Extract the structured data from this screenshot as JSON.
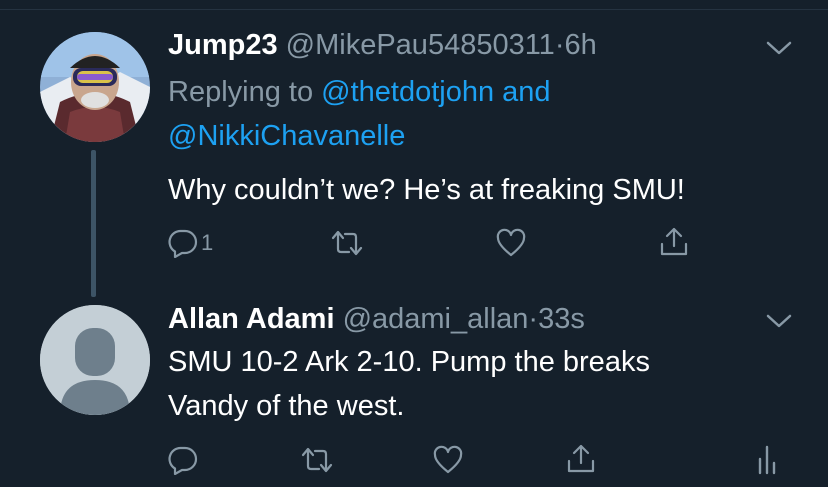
{
  "colors": {
    "background": "#15202b",
    "text": "#ffffff",
    "secondary": "#8899a6",
    "link": "#1da1f2",
    "thread_line": "#3d5466"
  },
  "tweet1": {
    "name": "Jump23",
    "handle": "@MikePau54850311",
    "separator": "·",
    "time": "6h",
    "replying_prefix": "Replying to",
    "mention1": "@thetdotjohn",
    "and_word": "and",
    "mention2": "@NikkiChavanelle",
    "text": "Why couldn’t we?  He’s at freaking SMU!",
    "reply_count": "1",
    "icons": [
      "reply-icon",
      "retweet-icon",
      "like-icon",
      "share-icon",
      "chevron-down-icon"
    ]
  },
  "tweet2": {
    "name": "Allan Adami",
    "handle": "@adami_allan",
    "separator": "·",
    "time": "33s",
    "text_line1": "SMU 10-2 Ark 2-10. Pump the breaks",
    "text_line2": "Vandy of the west.",
    "icons": [
      "reply-icon",
      "retweet-icon",
      "like-icon",
      "share-icon",
      "analytics-icon",
      "chevron-down-icon"
    ]
  }
}
